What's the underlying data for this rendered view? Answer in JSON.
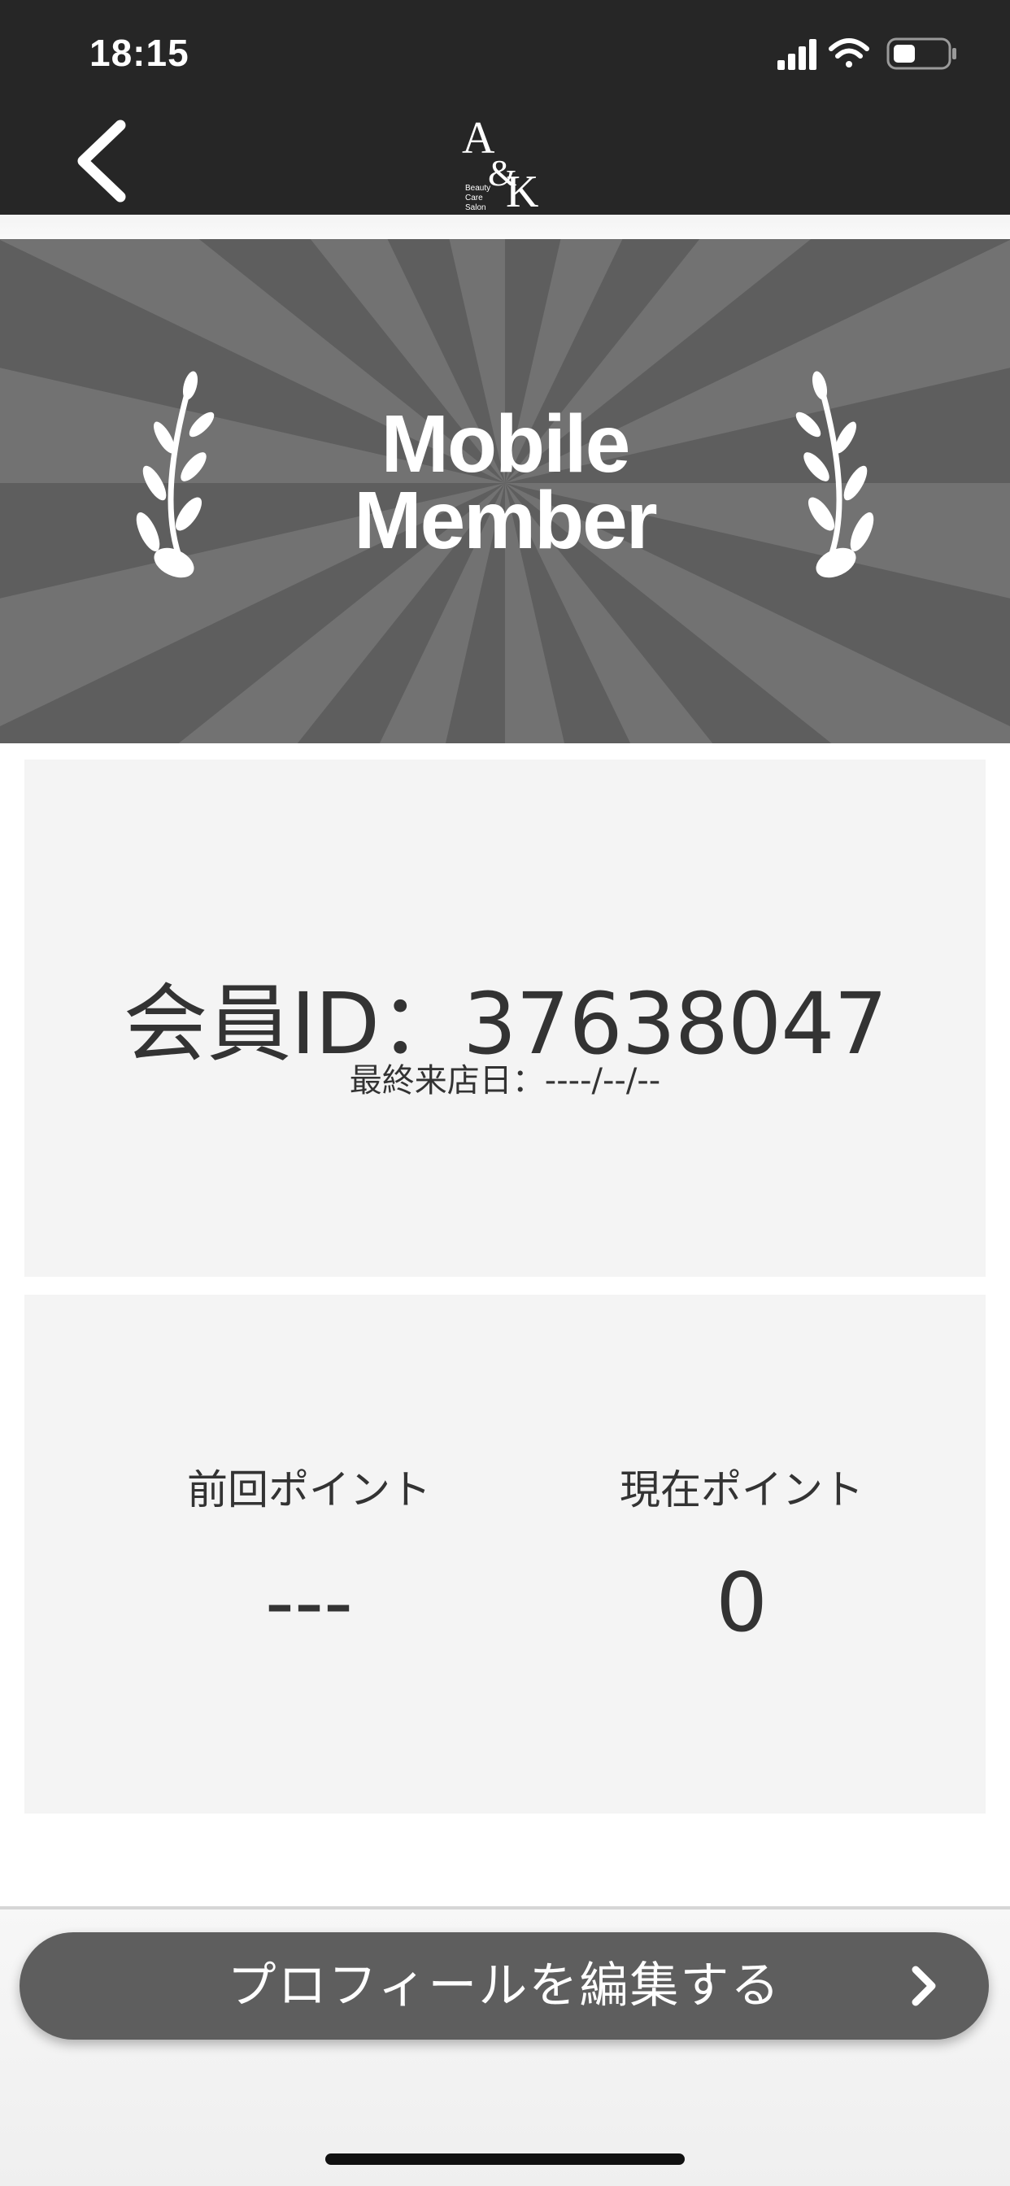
{
  "status_bar": {
    "time": "18:15"
  },
  "header": {
    "logo_main": "A&K",
    "logo_sub": [
      "Beauty",
      "Care",
      "Salon"
    ]
  },
  "banner": {
    "title_line1": "Mobile",
    "title_line2": "Member"
  },
  "member": {
    "id_text": "会員ID：37638047",
    "last_visit": "最終来店日：----/--/--"
  },
  "points": {
    "previous_label": "前回ポイント",
    "previous_value": "---",
    "current_label": "現在ポイント",
    "current_value": "0"
  },
  "actions": {
    "edit_profile_label": "プロフィールを編集する"
  },
  "colors": {
    "bar": "#262626",
    "banner_dark": "#5e5e5e",
    "banner_light": "#727272",
    "card": "#f4f4f4",
    "button": "#5e5e5e"
  }
}
